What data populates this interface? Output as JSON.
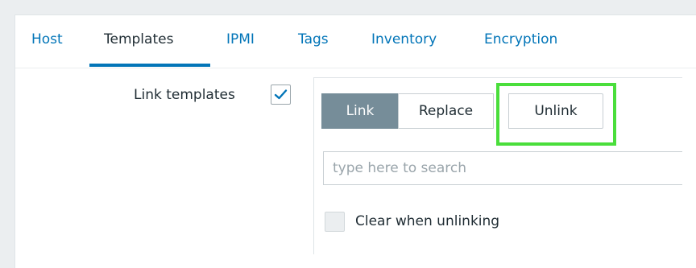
{
  "tabs": [
    {
      "label": "Host",
      "active": false
    },
    {
      "label": "Templates",
      "active": true
    },
    {
      "label": "IPMI",
      "active": false
    },
    {
      "label": "Tags",
      "active": false
    },
    {
      "label": "Inventory",
      "active": false
    },
    {
      "label": "Encryption",
      "active": false
    }
  ],
  "form": {
    "link_templates_label": "Link templates",
    "link_templates_checked": true,
    "mode_buttons": [
      {
        "label": "Link",
        "active": true
      },
      {
        "label": "Replace",
        "active": false
      },
      {
        "label": "Unlink",
        "active": false
      }
    ],
    "search_placeholder": "type here to search",
    "clear_label": "Clear when unlinking",
    "clear_checked": false
  },
  "colors": {
    "accent": "#0275b8",
    "highlight": "#4ade3b",
    "active_segment": "#768d99"
  }
}
